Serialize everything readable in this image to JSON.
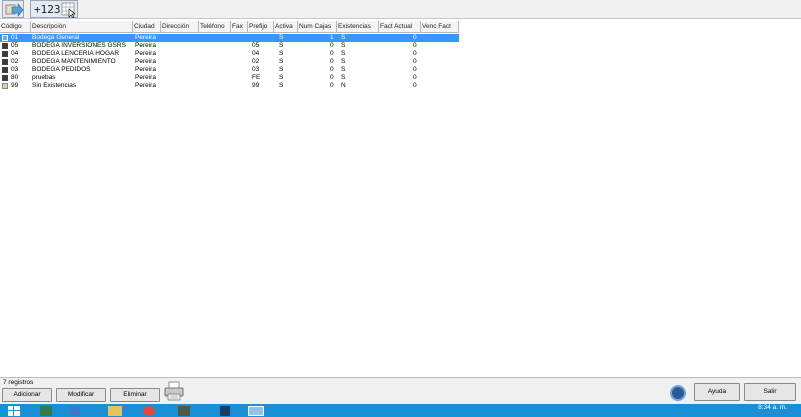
{
  "toolbar": {
    "counter_label": "+123"
  },
  "grid": {
    "columns": [
      "Código",
      "Descripción",
      "Ciudad",
      "Dirección",
      "Teléfono",
      "Fax",
      "Prefijo",
      "Activa",
      "Num Cajas",
      "Existencias",
      "Fact Actual",
      "Venc Fact"
    ],
    "rows": [
      {
        "code": "01",
        "desc": "Bodega General",
        "city": "Pereira",
        "prefix": "",
        "active": "S",
        "boxes": "1",
        "stock": "S",
        "fact": "0",
        "checked": true,
        "selected": true
      },
      {
        "code": "05",
        "desc": "BODEGA INVERSIONES GSRS",
        "city": "Pereira",
        "prefix": "05",
        "active": "S",
        "boxes": "0",
        "stock": "S",
        "fact": "0",
        "checked": true,
        "selected": false
      },
      {
        "code": "04",
        "desc": "BODEGA LENCERIA HOGAR",
        "city": "Pereira",
        "prefix": "04",
        "active": "S",
        "boxes": "0",
        "stock": "S",
        "fact": "0",
        "checked": true,
        "selected": false
      },
      {
        "code": "02",
        "desc": "BODEGA MANTENIMIENTO",
        "city": "Pereira",
        "prefix": "02",
        "active": "S",
        "boxes": "0",
        "stock": "S",
        "fact": "0",
        "checked": true,
        "selected": false
      },
      {
        "code": "03",
        "desc": "BODEGA PEDIDOS",
        "city": "Pereira",
        "prefix": "03",
        "active": "S",
        "boxes": "0",
        "stock": "S",
        "fact": "0",
        "checked": true,
        "selected": false
      },
      {
        "code": "80",
        "desc": "pruebas",
        "city": "Pereira",
        "prefix": "FE",
        "active": "S",
        "boxes": "0",
        "stock": "S",
        "fact": "0",
        "checked": true,
        "selected": false
      },
      {
        "code": "99",
        "desc": "Sin Existencias",
        "city": "Pereira",
        "prefix": "99",
        "active": "S",
        "boxes": "0",
        "stock": "N",
        "fact": "0",
        "checked": false,
        "selected": false
      }
    ]
  },
  "footer": {
    "record_count": "7 registros",
    "add_label": "Adicionar",
    "modify_label": "Modificar",
    "delete_label": "Eliminar",
    "help_label": "Ayuda",
    "exit_label": "Salir"
  },
  "taskbar": {
    "clock": "8:34 a. m."
  },
  "colors": {
    "selection": "#3399ff",
    "taskbar": "#1a8ed6"
  }
}
